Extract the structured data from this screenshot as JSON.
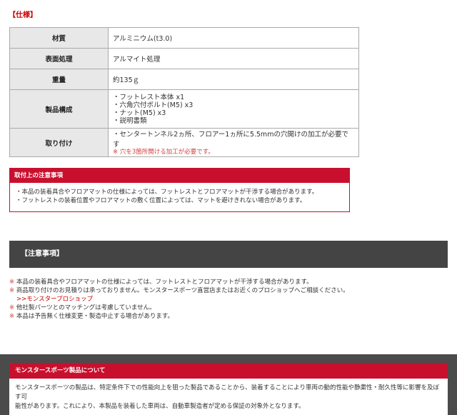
{
  "spec": {
    "title": "【仕様】",
    "rows": [
      {
        "label": "材質",
        "value": "アルミニウム(t3.0)"
      },
      {
        "label": "表面処理",
        "value": "アルマイト処理"
      },
      {
        "label": "重量",
        "value": "約135ｇ"
      },
      {
        "label": "製品構成",
        "items": [
          "・フットレスト本体 x1",
          "・六角穴付ボルト(M5) x3",
          "・ナット(M5) x3",
          "・説明書類"
        ]
      },
      {
        "label": "取り付け",
        "value": "・センタートンネル2ヵ所、フロアー1ヵ所に5.5mmの穴開けの加工が必要です",
        "note": "※ 穴を3箇所開ける加工が必要です。"
      }
    ]
  },
  "install_caution": {
    "title": "取付上の注意事項",
    "lines": [
      "・本品の装着具合やフロアマットの仕様によっては、フットレストとフロアマットが干渉する場合があります。",
      "・フットレストの装着位置やフロアマットの敷く位置によっては、マットを避けきれない場合があります。"
    ]
  },
  "notice": {
    "title": "【注意事項】",
    "mark": "※",
    "lines": [
      "本品の装着具合やフロアマットの仕様によっては、フットレストとフロアマットが干渉する場合があります。",
      "商品取り付けのお見積りは承っておりません。モンスタースポーツ直営店またはお近くのプロショップへご相談ください。"
    ],
    "link": ">>モンスタープロショップ",
    "lines2": [
      "他社製パーツとのマッチングは考慮していません。",
      "本品は予告無く仕様変更・製造中止する場合があります。"
    ]
  },
  "about": {
    "title": "モンスタースポーツ製品について",
    "lines": [
      "モンスタースポーツの製品は、特定条件下での性能向上を狙った製品であることから、装着することにより車両の動的性能や静粛性・耐久性等に影響を及ぼす可",
      "能性があります。これにより、本製品を装着した車両は、自動車製造者が定める保証の対象外となります。"
    ]
  }
}
